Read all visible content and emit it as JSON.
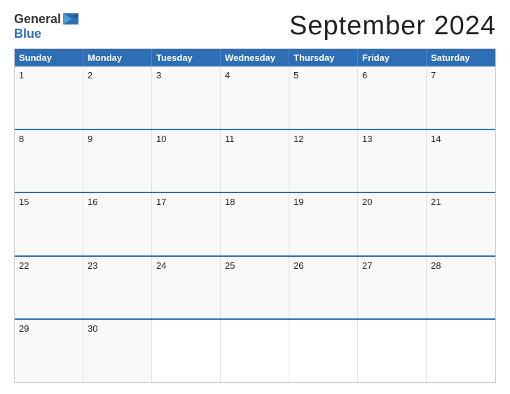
{
  "header": {
    "logo": {
      "general": "General",
      "blue": "Blue",
      "flag_alt": "General Blue Logo Flag"
    },
    "title": "September 2024"
  },
  "calendar": {
    "days_of_week": [
      "Sunday",
      "Monday",
      "Tuesday",
      "Wednesday",
      "Thursday",
      "Friday",
      "Saturday"
    ],
    "weeks": [
      [
        1,
        2,
        3,
        4,
        5,
        6,
        7
      ],
      [
        8,
        9,
        10,
        11,
        12,
        13,
        14
      ],
      [
        15,
        16,
        17,
        18,
        19,
        20,
        21
      ],
      [
        22,
        23,
        24,
        25,
        26,
        27,
        28
      ],
      [
        29,
        30,
        null,
        null,
        null,
        null,
        null
      ]
    ]
  },
  "colors": {
    "header_bg": "#2e6eb5",
    "accent": "#2e6eb5",
    "text_dark": "#222222",
    "text_white": "#ffffff",
    "cell_bg": "#f9f9f9",
    "border": "#2e6eb5"
  }
}
